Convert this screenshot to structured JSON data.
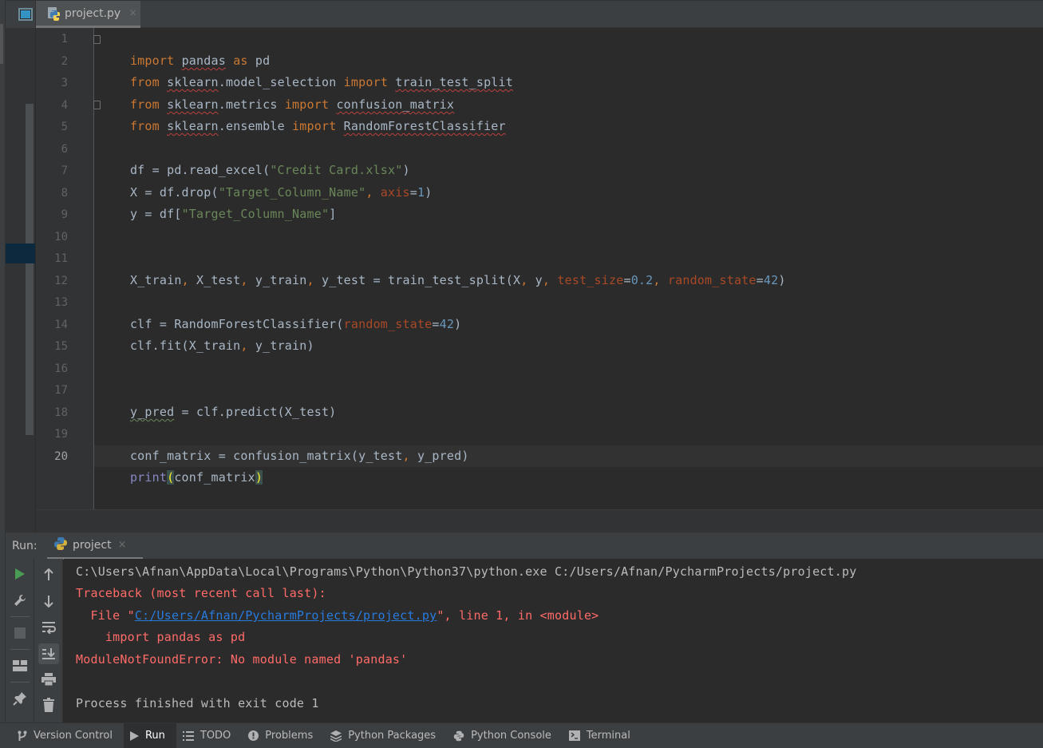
{
  "editor": {
    "tab": {
      "label": "project.py",
      "close": "×"
    },
    "current_line": 20,
    "line_numbers": [
      "1",
      "2",
      "3",
      "4",
      "5",
      "6",
      "7",
      "8",
      "9",
      "10",
      "11",
      "12",
      "13",
      "14",
      "15",
      "16",
      "17",
      "18",
      "19",
      "20"
    ],
    "code": {
      "l1": {
        "kw1": "import",
        "mod": "pandas",
        "kw2": "as",
        "alias": "pd"
      },
      "l2": {
        "kw1": "from",
        "pkg": "sklearn",
        "rest": ".model_selection",
        "kw2": "import",
        "name": "train_test_split"
      },
      "l3": {
        "kw1": "from",
        "pkg": "sklearn",
        "rest": ".metrics",
        "kw2": "import",
        "name": "confusion_matrix"
      },
      "l4": {
        "kw1": "from",
        "pkg": "sklearn",
        "rest": ".ensemble",
        "kw2": "import",
        "name": "RandomForestClassifier"
      },
      "l6": {
        "pre": "df = pd.read_excel(",
        "str": "\"Credit Card.xlsx\"",
        "post": ")"
      },
      "l7": {
        "pre": "X = df.drop(",
        "str": "\"Target_Column_Name\"",
        "comma": ",",
        "param": " axis",
        "eq": "=",
        "num": "1",
        "post": ")"
      },
      "l8": {
        "pre": "y = df[",
        "str": "\"Target_Column_Name\"",
        "post": "]"
      },
      "l11": {
        "a": "X_train",
        "c1": ",",
        "b": " X_test",
        "c2": ",",
        "c": " y_train",
        "c3": ",",
        "d": " y_test = train_test_split(X",
        "c4": ",",
        "e": " y",
        "c5": ",",
        "p1": " test_size",
        "eq1": "=",
        "n1": "0.2",
        "c6": ",",
        "p2": " random_state",
        "eq2": "=",
        "n2": "42",
        "end": ")"
      },
      "l13": {
        "pre": "clf = RandomForestClassifier(",
        "param": "random_state",
        "eq": "=",
        "num": "42",
        "post": ")"
      },
      "l14": {
        "pre": "clf.fit(X_train",
        "comma": ",",
        "post": " y_train)"
      },
      "l17": {
        "var": "y_pred",
        "post": " = clf.predict(X_test)"
      },
      "l19": {
        "pre": "conf_matrix = confusion_matrix(y_test",
        "comma": ",",
        "post": " y_pred)"
      },
      "l20": {
        "fn": "print",
        "open": "(",
        "arg": "conf_matrix",
        "close": ")"
      }
    }
  },
  "run_panel": {
    "label": "Run:",
    "tab": {
      "label": "project",
      "close": "×"
    },
    "console": {
      "cmd": "C:\\Users\\Afnan\\AppData\\Local\\Programs\\Python\\Python37\\python.exe C:/Users/Afnan/PycharmProjects/project.py",
      "traceback": "Traceback (most recent call last):",
      "file_pre": "  File \"",
      "file_link": "C:/Users/Afnan/PycharmProjects/project.py",
      "file_post": "\", line 1, in <module>",
      "src": "    import pandas as pd",
      "error": "ModuleNotFoundError: No module named 'pandas'",
      "finished": "Process finished with exit code 1"
    }
  },
  "bottom_bar": {
    "items": [
      {
        "label": "Version Control",
        "icon": "branch-icon"
      },
      {
        "label": "Run",
        "icon": "run-icon",
        "active": true
      },
      {
        "label": "TODO",
        "icon": "list-icon"
      },
      {
        "label": "Problems",
        "icon": "warning-icon"
      },
      {
        "label": "Python Packages",
        "icon": "layers-icon"
      },
      {
        "label": "Python Console",
        "icon": "python-icon"
      },
      {
        "label": "Terminal",
        "icon": "terminal-icon"
      }
    ]
  },
  "colors": {
    "keyword": "#cc7832",
    "string": "#6a8759",
    "number": "#6897bb",
    "param": "#aa4926",
    "error": "#ff6b68",
    "link": "#287bde",
    "run_green": "#499c54"
  }
}
